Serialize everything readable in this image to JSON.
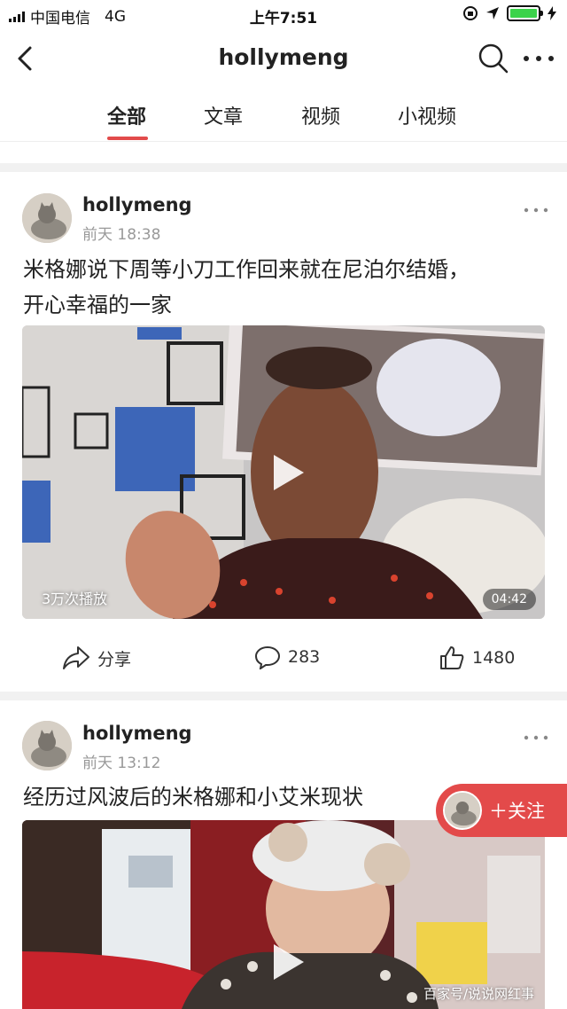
{
  "status_bar": {
    "carrier": "中国电信",
    "network": "4G",
    "time": "上午7:51"
  },
  "nav": {
    "title": "hollymeng"
  },
  "tabs": [
    {
      "label": "全部",
      "active": true
    },
    {
      "label": "文章",
      "active": false
    },
    {
      "label": "视频",
      "active": false
    },
    {
      "label": "小视频",
      "active": false
    }
  ],
  "posts": [
    {
      "author": "hollymeng",
      "time": "前天 18:38",
      "title_line1": "米格娜说下周等小刀工作回来就在尼泊尔结婚，",
      "title_line2": "开心幸福的一家",
      "views": "3万次播放",
      "duration": "04:42",
      "share_label": "分享",
      "comments": "283",
      "likes": "1480"
    },
    {
      "author": "hollymeng",
      "time": "前天 13:12",
      "title_line1": "经历过风波后的米格娜和小艾米现状"
    }
  ],
  "follow": {
    "label": "＋关注"
  },
  "watermark": "百家号/说说网红事",
  "colors": {
    "accent": "#e24b4b",
    "follow_bg": "#e34a4a",
    "battery": "#3bd34a"
  }
}
